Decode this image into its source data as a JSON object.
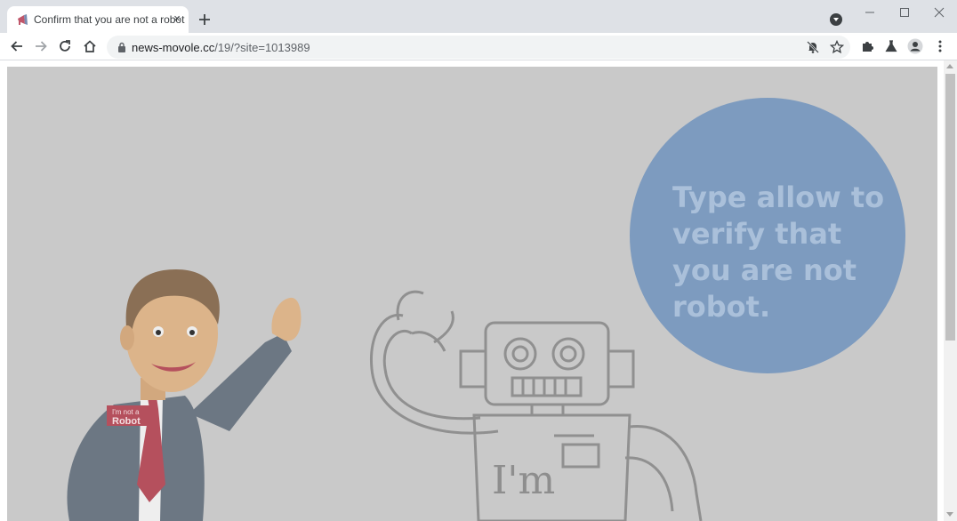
{
  "browser": {
    "tab": {
      "title": "Confirm that you are not a robot",
      "favicon": "megaphone-icon",
      "close": "×"
    },
    "new_tab_icon": "plus-icon",
    "window_controls": [
      "minimize-icon",
      "maximize-icon",
      "close-icon"
    ],
    "toolbar": {
      "url_host": "news-movole.cc",
      "url_path": "/19/?site=1013989",
      "icons": [
        "back-icon",
        "forward-icon",
        "reload-icon",
        "home-icon",
        "lock-icon",
        "notifications-blocked-icon",
        "star-icon",
        "extensions-icon",
        "labs-icon",
        "profile-icon",
        "menu-icon"
      ]
    }
  },
  "page": {
    "bubble_text": "Type allow to verify that you are not robot.",
    "badge_line1": "I'm not a",
    "badge_line2": "Robot",
    "robot_label": "I'm",
    "colors": {
      "overlay_bg": "#c9c9c9",
      "bubble": "#7d9bbf",
      "bubble_text": "#aac0da"
    }
  }
}
